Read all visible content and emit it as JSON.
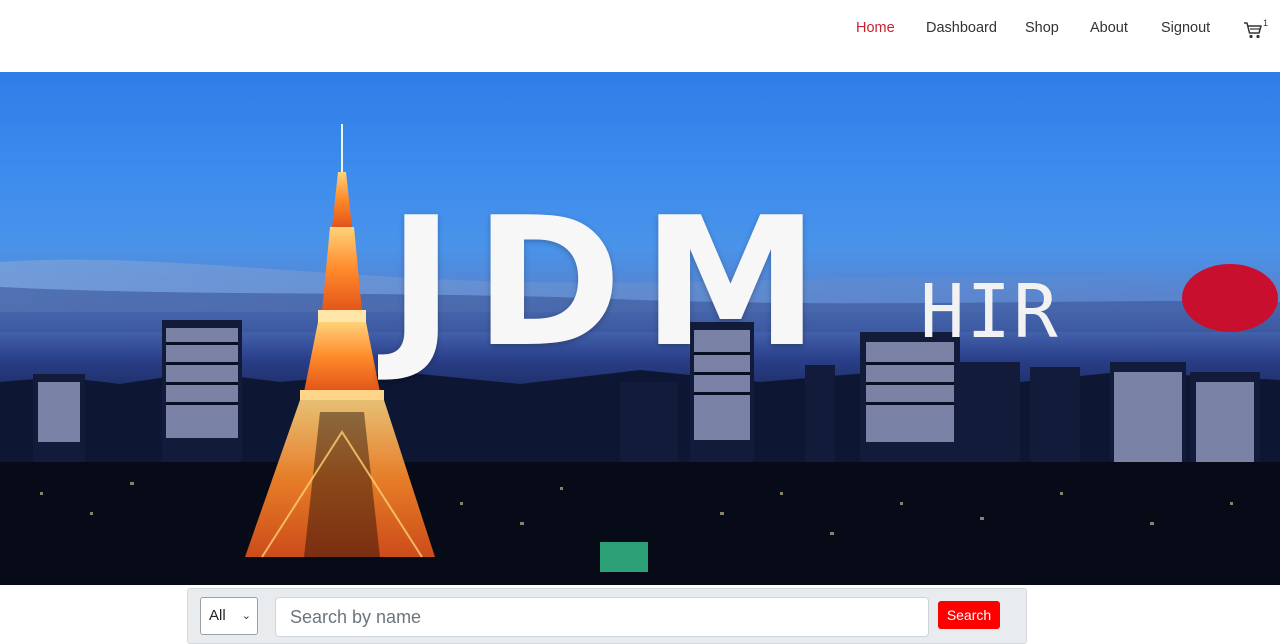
{
  "nav": {
    "items": [
      {
        "label": "Home",
        "active": true
      },
      {
        "label": "Dashboard",
        "active": false
      },
      {
        "label": "Shop",
        "active": false
      },
      {
        "label": "About",
        "active": false
      },
      {
        "label": "Signout",
        "active": false
      }
    ],
    "cart": {
      "icon": "cart-icon",
      "count": "1"
    }
  },
  "hero": {
    "logo_main": "JDM",
    "logo_sub": "HIR",
    "sun_color": "#c8102e"
  },
  "search": {
    "filter_value": "All",
    "placeholder": "Search by name",
    "button_label": "Search"
  },
  "colors": {
    "accent": "#c8222f",
    "search_button": "#ff0000",
    "panel_bg": "#e9ecef"
  }
}
